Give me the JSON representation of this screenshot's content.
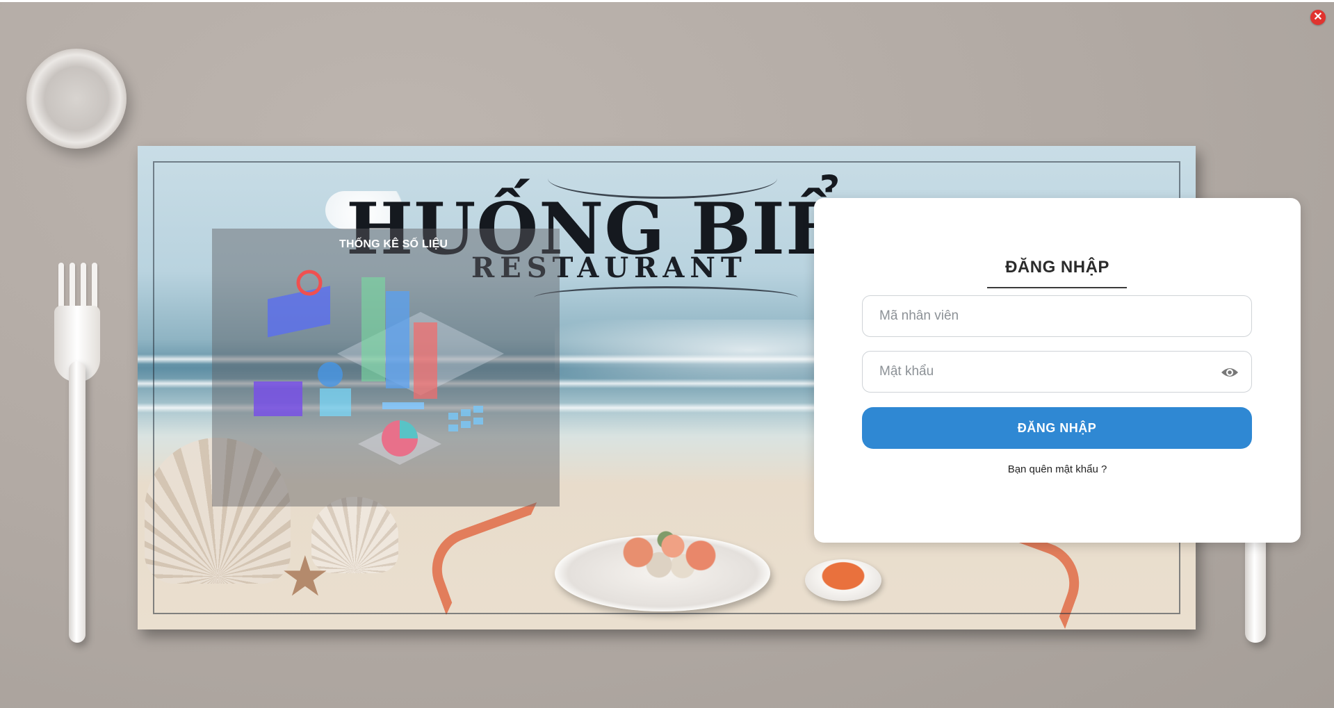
{
  "window": {
    "close_label": "✕"
  },
  "background": {
    "restaurant_name": "HUỐNG BIỂ",
    "restaurant_subtitle": "RESTAURANT"
  },
  "stats_panel": {
    "title": "THỐNG KÊ SỐ LIỆU"
  },
  "login": {
    "heading": "ĐĂNG NHẬP",
    "employee_id": {
      "placeholder": "Mã nhân viên",
      "value": ""
    },
    "password": {
      "placeholder": "Mật khẩu",
      "value": ""
    },
    "submit_label": "ĐĂNG NHẬP",
    "forgot_link": "Bạn quên mật khẩu ?"
  },
  "colors": {
    "accent": "#2f88d3",
    "close": "#e0342f",
    "card": "#ffffff"
  },
  "icons": {
    "close": "close-icon",
    "password_toggle": "eye-icon"
  }
}
